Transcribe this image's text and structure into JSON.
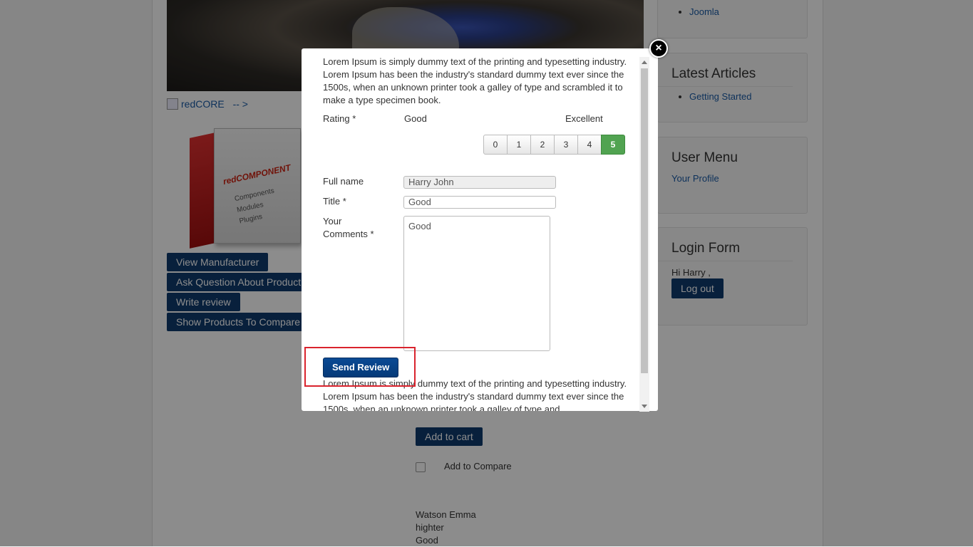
{
  "background": {
    "redcore_link": "redCORE",
    "redcore_arrow": "-- >",
    "box_brand": "redCOMPONENT",
    "box_lines": [
      "Components",
      "Modules",
      "Plugins"
    ],
    "buttons": {
      "view_manufacturer": "View Manufacturer",
      "ask_question": "Ask Question About Product",
      "write_review": "Write review",
      "show_compare": "Show Products To Compare",
      "add_to_cart": "Add to cart",
      "logout": "Log out"
    },
    "add_to_compare": "Add to Compare",
    "review_lines": [
      "Watson Emma",
      "highter",
      "Good"
    ],
    "sidebar": {
      "top_link": "Joomla",
      "latest_title": "Latest Articles",
      "latest_link": "Getting Started",
      "user_menu_title": "User Menu",
      "user_menu_link": "Your Profile",
      "login_title": "Login Form",
      "greeting": "Hi Harry ,"
    }
  },
  "modal": {
    "intro_text": "Lorem Ipsum is simply dummy text of the printing and typesetting industry. Lorem Ipsum has been the industry's standard dummy text ever since the 1500s, when an unknown printer took a galley of type and scrambled it to make a type specimen book.",
    "rating_label": "Rating *",
    "rating_low": "Good",
    "rating_high": "Excellent",
    "rating_options": [
      "0",
      "1",
      "2",
      "3",
      "4",
      "5"
    ],
    "rating_selected": "5",
    "fullname_label": "Full name",
    "fullname_value": "Harry  John",
    "title_label": "Title *",
    "title_value": "Good",
    "comments_label_1": "Your",
    "comments_label_2": "Comments *",
    "comments_value": "Good",
    "send_button": "Send Review",
    "footer_text": "Lorem Ipsum is simply dummy text of the printing and typesetting industry. Lorem Ipsum has been the industry's standard dummy text ever since the 1500s, when an unknown printer took a galley of type and"
  },
  "colors": {
    "accent": "#0f3b6e",
    "selected": "#51a351",
    "highlight": "#d9232d"
  },
  "icons": {
    "close": "close-icon"
  }
}
